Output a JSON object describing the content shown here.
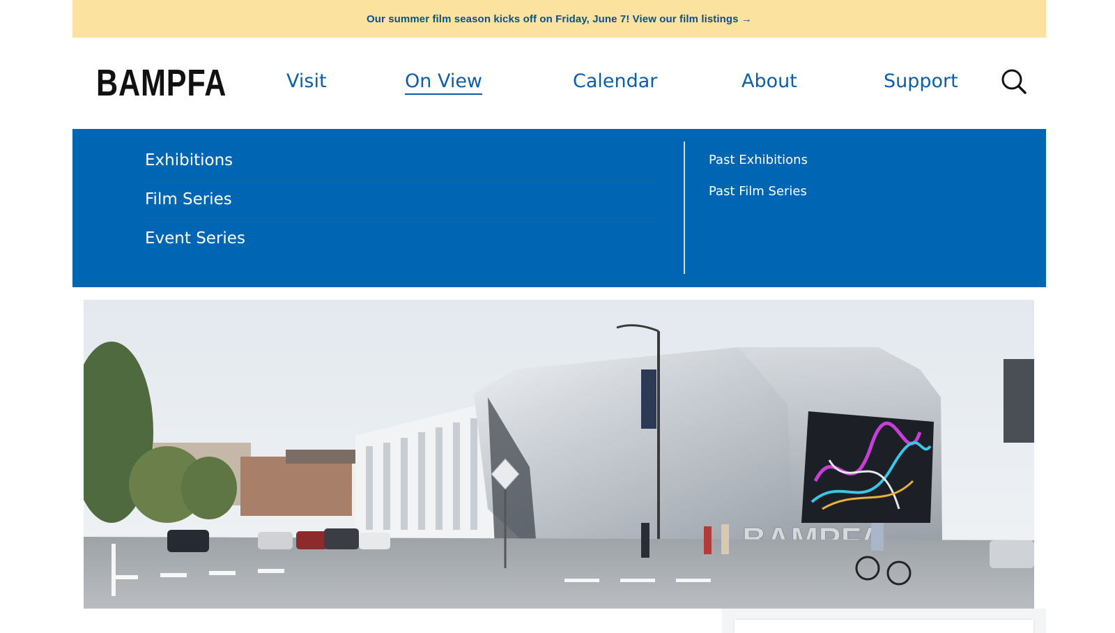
{
  "announcement": {
    "text": "Our summer film season kicks off on Friday, June 7! View our film listings →"
  },
  "brand": {
    "logo_text": "BAMPFA"
  },
  "nav": {
    "items": [
      {
        "label": "Visit",
        "active": false
      },
      {
        "label": "On View",
        "active": true
      },
      {
        "label": "Calendar",
        "active": false
      },
      {
        "label": "About",
        "active": false
      },
      {
        "label": "Support",
        "active": false
      }
    ],
    "search_icon": "search-icon"
  },
  "dropdown": {
    "primary": [
      {
        "label": "Exhibitions"
      },
      {
        "label": "Film Series"
      },
      {
        "label": "Event Series"
      }
    ],
    "secondary": [
      {
        "label": "Past Exhibitions"
      },
      {
        "label": "Past Film Series"
      }
    ]
  },
  "hero": {
    "building_sign": "BAMPFA"
  },
  "colors": {
    "announcement_bg": "#fbe29e",
    "nav_text": "#0b5ea8",
    "dropdown_bg": "#0066b3"
  }
}
